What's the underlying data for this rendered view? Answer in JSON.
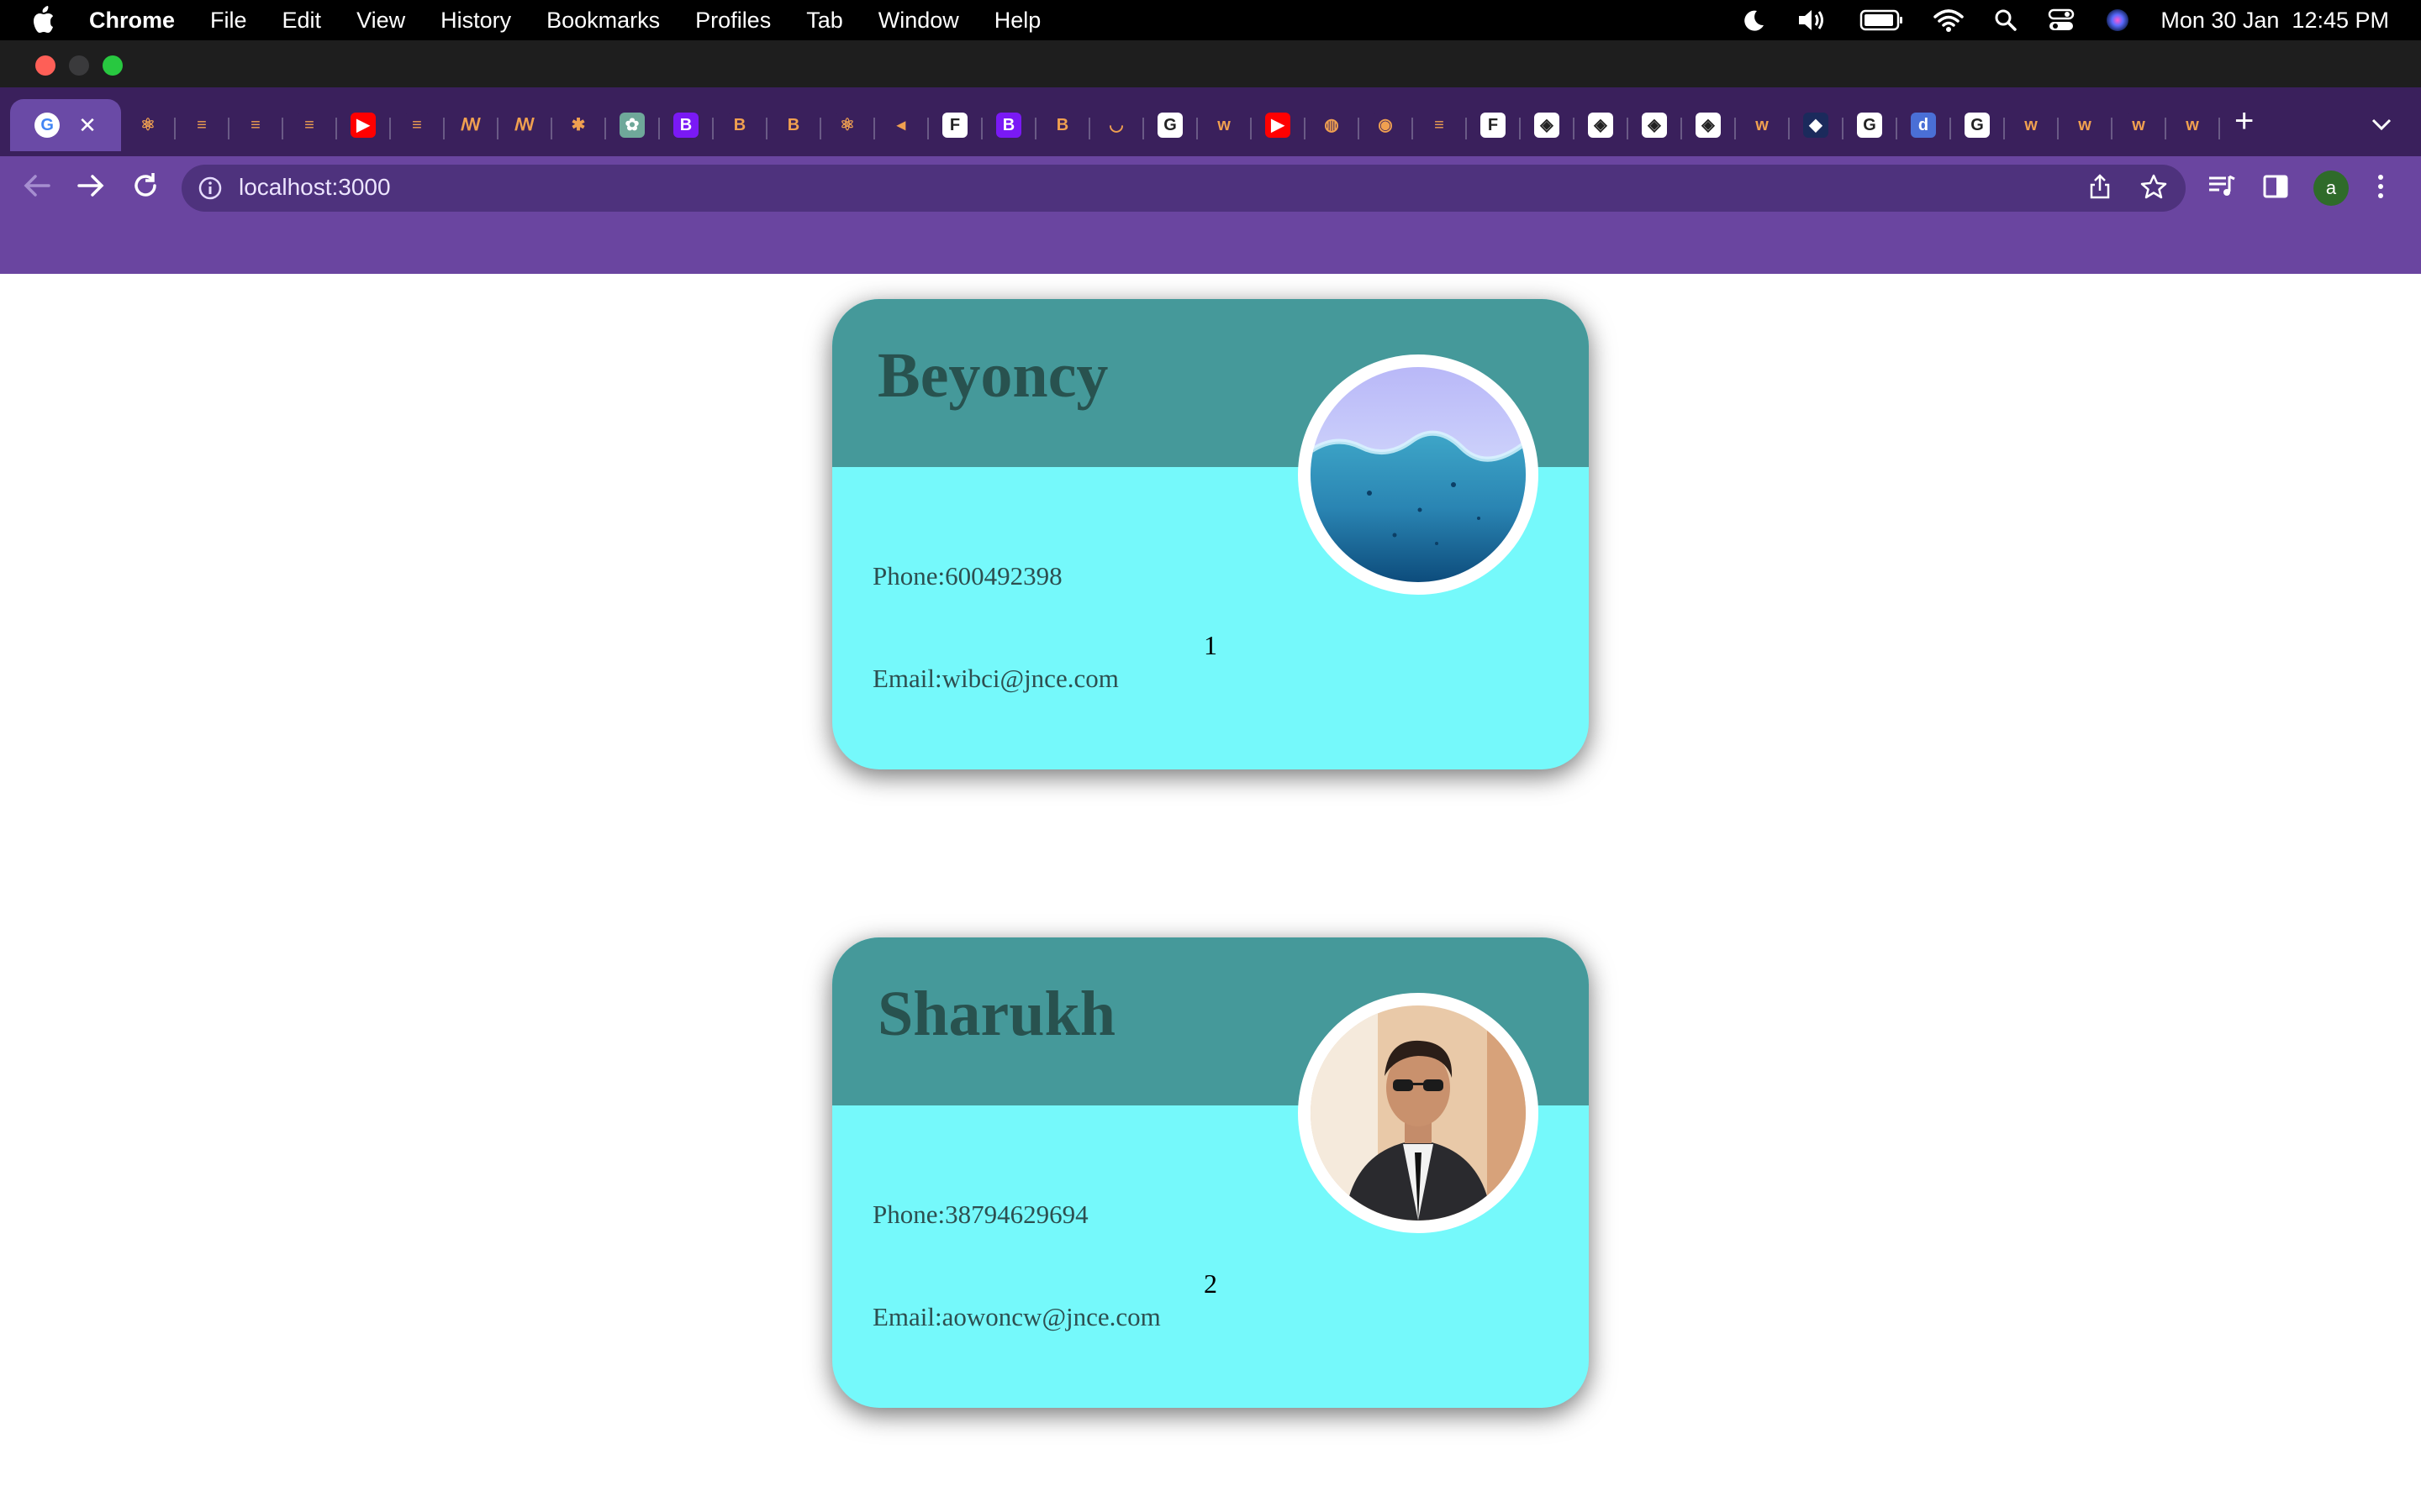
{
  "menubar": {
    "items": [
      "Chrome",
      "File",
      "Edit",
      "View",
      "History",
      "Bookmarks",
      "Profiles",
      "Tab",
      "Window",
      "Help"
    ],
    "clock": "Mon 30 Jan  12:45 PM",
    "status_icons": [
      "moon-icon",
      "volume-icon",
      "battery-icon",
      "wifi-icon",
      "spotlight-icon",
      "control-center-icon",
      "siri-icon"
    ]
  },
  "tabs": {
    "active_close": "✕",
    "favicons": [
      {
        "icon": "google-icon",
        "text": "G",
        "color": "#ffffff"
      },
      {
        "icon": "react-icon",
        "text": "⚛",
        "color": "#3a205c"
      },
      {
        "icon": "stackoverflow-icon",
        "text": "≡",
        "color": "#3a205c"
      },
      {
        "icon": "stackoverflow-icon",
        "text": "≡",
        "color": "#3a205c"
      },
      {
        "icon": "stackoverflow-icon",
        "text": "≡",
        "color": "#3a205c"
      },
      {
        "icon": "youtube-icon",
        "text": "▶",
        "color": "#ff0000"
      },
      {
        "icon": "stackoverflow-icon",
        "text": "≡",
        "color": "#3a205c"
      },
      {
        "icon": "medium-icon",
        "text": "ꟿ",
        "color": "#3a205c"
      },
      {
        "icon": "medium-icon",
        "text": "ꟿ",
        "color": "#3a205c"
      },
      {
        "icon": "unknown-icon",
        "text": "✱",
        "color": "#3a205c"
      },
      {
        "icon": "chatgpt-icon",
        "text": "✿",
        "color": "#6fa89a"
      },
      {
        "icon": "bootstrap-icon",
        "text": "B",
        "color": "#7a19f5"
      },
      {
        "icon": "bootstrap-icon",
        "text": "B",
        "color": "#3a205c"
      },
      {
        "icon": "bootstrap-icon",
        "text": "B",
        "color": "#3a205c"
      },
      {
        "icon": "react-icon",
        "text": "⚛",
        "color": "#3a205c"
      },
      {
        "icon": "speaker-icon",
        "text": "◂",
        "color": "#3a205c"
      },
      {
        "icon": "framer-icon",
        "text": "F",
        "color": "#ffffff"
      },
      {
        "icon": "bootstrap-icon",
        "text": "B",
        "color": "#7a19f5"
      },
      {
        "icon": "bootstrap-icon",
        "text": "B",
        "color": "#3a205c"
      },
      {
        "icon": "loading-icon",
        "text": "◡",
        "color": "#3a205c"
      },
      {
        "icon": "google-icon",
        "text": "G",
        "color": "#ffffff"
      },
      {
        "icon": "w3schools-icon",
        "text": "w",
        "color": "#3a205c"
      },
      {
        "icon": "youtube-icon",
        "text": "▶",
        "color": "#ff0000"
      },
      {
        "icon": "globe-icon",
        "text": "◍",
        "color": "#3a205c"
      },
      {
        "icon": "chrome-icon",
        "text": "◉",
        "color": "#3a205c"
      },
      {
        "icon": "stackoverflow-icon",
        "text": "≡",
        "color": "#3a205c"
      },
      {
        "icon": "framer-icon",
        "text": "F",
        "color": "#ffffff"
      },
      {
        "icon": "codepen-icon",
        "text": "◈",
        "color": "#ffffff"
      },
      {
        "icon": "codepen-icon",
        "text": "◈",
        "color": "#ffffff"
      },
      {
        "icon": "codepen-icon",
        "text": "◈",
        "color": "#ffffff"
      },
      {
        "icon": "codepen-icon",
        "text": "◈",
        "color": "#ffffff"
      },
      {
        "icon": "w3schools-icon",
        "text": "w",
        "color": "#3a205c"
      },
      {
        "icon": "dark-app-icon",
        "text": "◆",
        "color": "#1b2a5c"
      },
      {
        "icon": "google-icon",
        "text": "G",
        "color": "#ffffff"
      },
      {
        "icon": "d-icon",
        "text": "d",
        "color": "#4a6fd6"
      },
      {
        "icon": "google-icon",
        "text": "G",
        "color": "#ffffff"
      },
      {
        "icon": "w3schools-icon",
        "text": "w",
        "color": "#3a205c"
      },
      {
        "icon": "w3schools-icon",
        "text": "w",
        "color": "#3a205c"
      },
      {
        "icon": "w3schools-icon",
        "text": "w",
        "color": "#3a205c"
      },
      {
        "icon": "w3schools-icon",
        "text": "w",
        "color": "#3a205c"
      }
    ],
    "new_tab": "+"
  },
  "toolbar": {
    "url": "localhost:3000",
    "avatar": "a"
  },
  "cards": [
    {
      "name": "Beyoncy",
      "phone": "Phone:600492398",
      "email": "Email:wibci@jnce.com",
      "number": "1",
      "photo": "water-photo"
    },
    {
      "name": "Sharukh",
      "phone": "Phone:38794629694",
      "email": "Email:aowoncw@jnce.com",
      "number": "2",
      "photo": "man-in-suit-photo"
    }
  ],
  "colors": {
    "card_top": "#45999a",
    "card_body": "#75f9fb",
    "browser_purple": "#6a45a0"
  }
}
